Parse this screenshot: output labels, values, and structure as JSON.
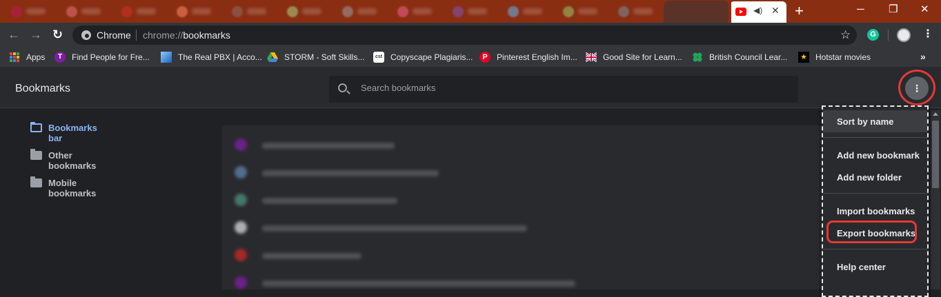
{
  "browser": {
    "tabs_colors": [
      "#c2185b",
      "#e57373",
      "#d32f2f",
      "#ff8a65",
      "#8d6e63",
      "#aed581",
      "#9e9e9e",
      "#f06292",
      "#7e57c2",
      "#64b5f6",
      "#9ccc65",
      "#78909c"
    ],
    "current_tab_icon": "youtube-icon",
    "omnibox": {
      "label": "Chrome",
      "url_scheme": "chrome://",
      "url_path": "bookmarks"
    },
    "colors": {
      "tabstrip": "#8a2e12",
      "accent": "#8ab4f8",
      "highlight": "#e53935"
    }
  },
  "bookmarks_bar": [
    {
      "label": "Apps",
      "icon": "apps-grid-icon"
    },
    {
      "label": "Find People for Fre...",
      "icon": "purple-t-icon"
    },
    {
      "label": "The Real PBX | Acco...",
      "icon": "pbx-icon"
    },
    {
      "label": "STORM - Soft Skills...",
      "icon": "google-drive-icon"
    },
    {
      "label": "Copyscape Plagiaris...",
      "icon": "copyscape-icon"
    },
    {
      "label": "Pinterest English Im...",
      "icon": "pinterest-icon"
    },
    {
      "label": "Good Site for Learn...",
      "icon": "uk-flag-icon"
    },
    {
      "label": "British Council Lear...",
      "icon": "british-council-icon"
    },
    {
      "label": "Hotstar movies",
      "icon": "hotstar-icon"
    }
  ],
  "page": {
    "title": "Bookmarks",
    "search_placeholder": "Search bookmarks"
  },
  "sidebar": {
    "items": [
      {
        "label": "Bookmarks bar",
        "active": true
      },
      {
        "label": "Other bookmarks",
        "active": false
      },
      {
        "label": "Mobile bookmarks",
        "active": false
      }
    ]
  },
  "menu": {
    "items": [
      {
        "label": "Sort by name"
      },
      {
        "label": "Add new bookmark"
      },
      {
        "label": "Add new folder"
      },
      {
        "label": "Import bookmarks"
      },
      {
        "label": "Export bookmarks"
      },
      {
        "label": "Help center"
      }
    ]
  }
}
